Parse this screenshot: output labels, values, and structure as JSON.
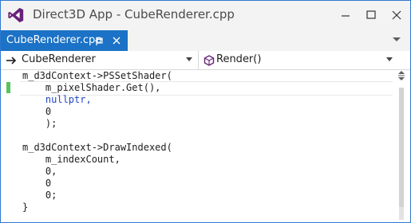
{
  "window": {
    "title": "Direct3D App - CubeRenderer.cpp",
    "colors": {
      "accent": "#1b72c6",
      "vs_purple": "#68217a",
      "change_marker": "#57c35d",
      "keyword": "#1f47c2"
    }
  },
  "tabs": [
    {
      "label": "CubeRenderer.cpp",
      "active": true,
      "icons": [
        "pin-icon",
        "close-icon"
      ]
    }
  ],
  "navigation": {
    "type_dropdown": {
      "value": "CubeRenderer",
      "icon": "arrow-right-icon"
    },
    "member_dropdown": {
      "value": "Render()",
      "icon": "method-cube-icon"
    }
  },
  "editor": {
    "code_lines": [
      "m_d3dContext->PSSetShader(",
      "    m_pixelShader.Get(),",
      "    nullptr,",
      "    0",
      "    );",
      "",
      "m_d3dContext->DrawIndexed(",
      "    m_indexCount,",
      "    0,",
      "    0",
      "    0;",
      "}"
    ],
    "keyword": "nullptr"
  }
}
